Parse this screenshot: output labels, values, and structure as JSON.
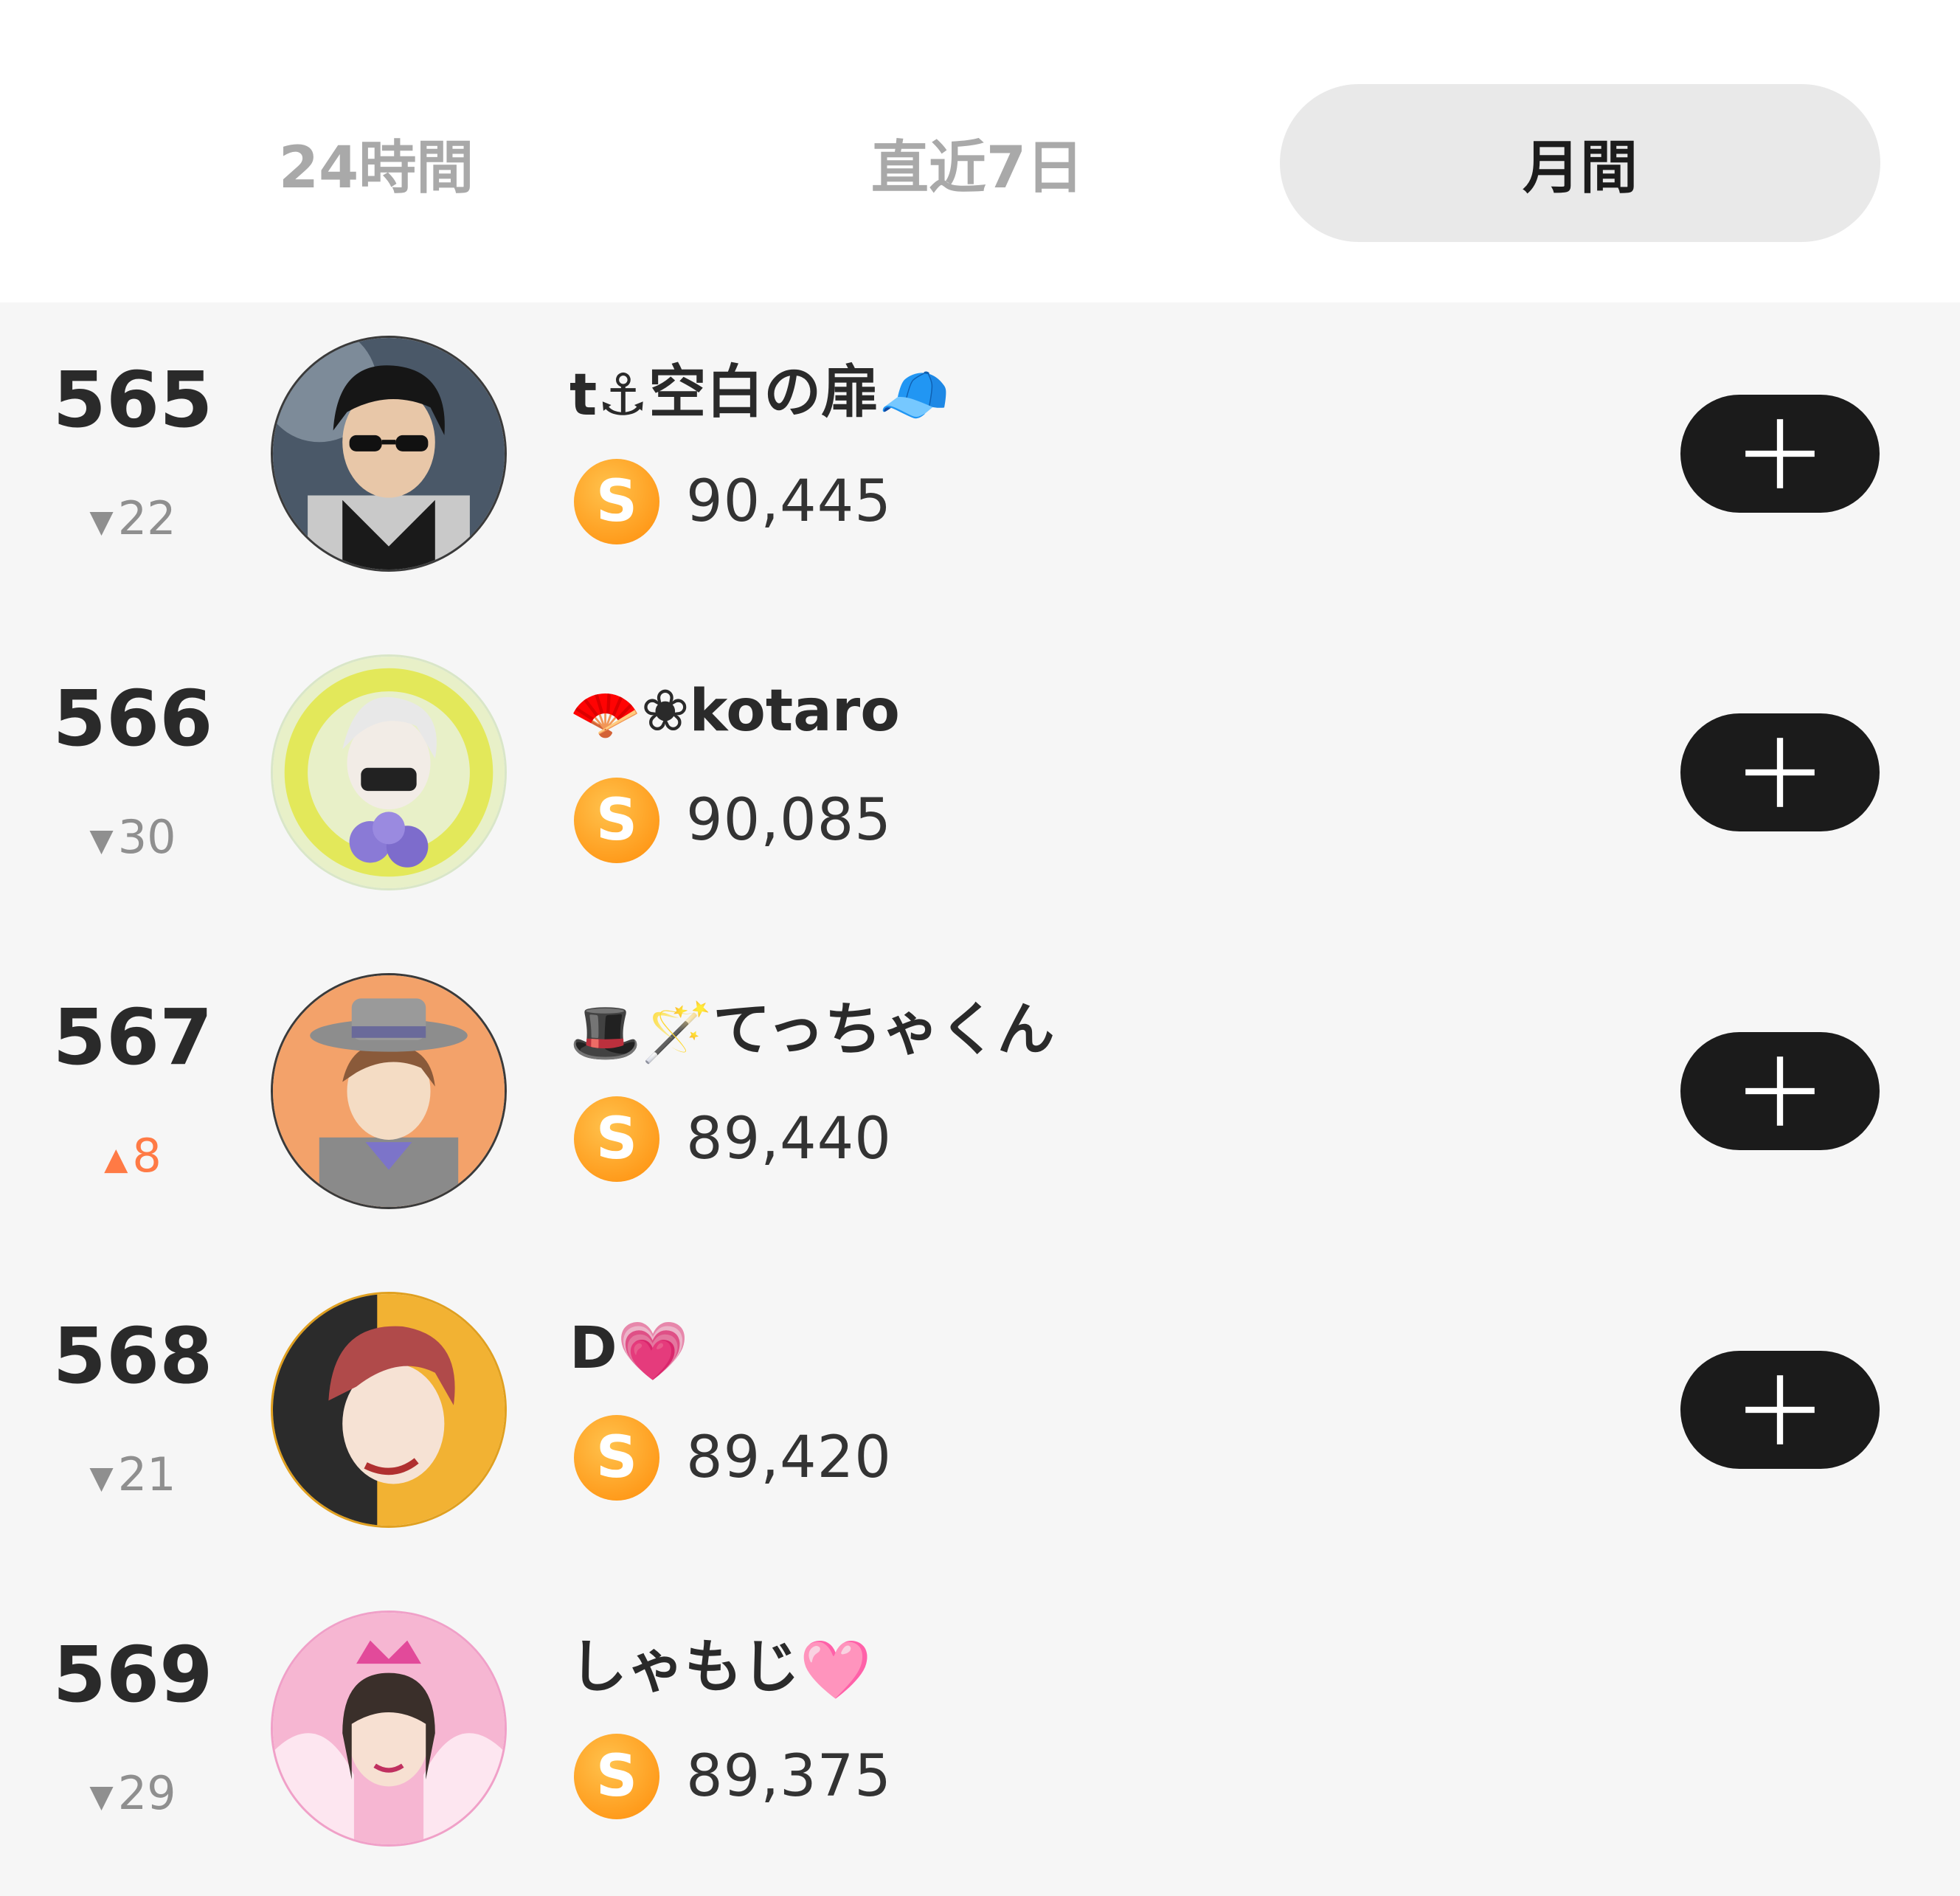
{
  "tabs": [
    {
      "label": "24時間",
      "selected": false
    },
    {
      "label": "直近7日",
      "selected": false
    },
    {
      "label": "月間",
      "selected": true
    }
  ],
  "coin_symbol": "S",
  "ranking": [
    {
      "rank": "565",
      "change_dir": "down",
      "change": "22",
      "name_prefix": "t⚓",
      "name": "空白の扉",
      "name_suffix": "🧢",
      "coins": "90,445",
      "follow": true
    },
    {
      "rank": "566",
      "change_dir": "down",
      "change": "30",
      "name_prefix": "🪭",
      "name": "❀kotaro",
      "name_suffix": "",
      "coins": "90,085",
      "follow": true
    },
    {
      "rank": "567",
      "change_dir": "up",
      "change": "8",
      "name_prefix": "🎩🪄",
      "name": "てっちゃくん",
      "name_suffix": "",
      "coins": "89,440",
      "follow": true
    },
    {
      "rank": "568",
      "change_dir": "down",
      "change": "21",
      "name_prefix": "",
      "name": "D",
      "name_suffix": "💗",
      "coins": "89,420",
      "follow": true
    },
    {
      "rank": "569",
      "change_dir": "down",
      "change": "29",
      "name_prefix": "",
      "name": "しゃもじ",
      "name_suffix": "🩷",
      "coins": "89,375",
      "follow": false
    }
  ],
  "icons": {
    "down": "triangle-down",
    "up": "triangle-up",
    "follow": "plus-icon",
    "coin": "coin-s-icon"
  },
  "colors": {
    "selected_tab_bg": "#e9e9e9",
    "up": "#ff7a45",
    "down": "#8f8f8f",
    "coin": "#ff9a1a",
    "button": "#1b1b1b"
  }
}
